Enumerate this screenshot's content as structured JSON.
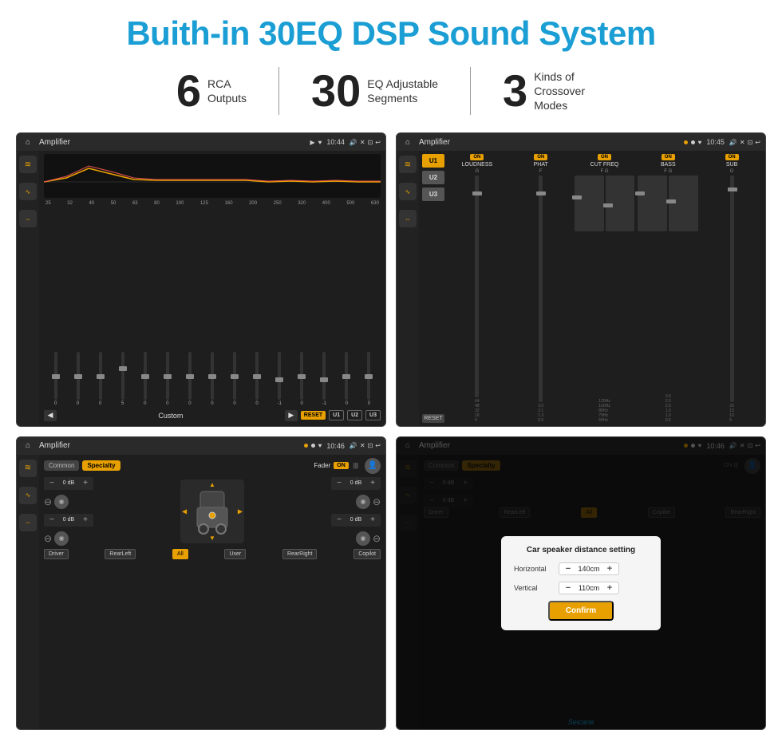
{
  "header": {
    "title": "Buith-in 30EQ DSP Sound System"
  },
  "stats": [
    {
      "number": "6",
      "label": "RCA\nOutputs"
    },
    {
      "number": "30",
      "label": "EQ Adjustable\nSegments"
    },
    {
      "number": "3",
      "label": "Kinds of\nCrossover Modes"
    }
  ],
  "screens": {
    "screen1": {
      "topbar": {
        "title": "Amplifier",
        "time": "10:44"
      },
      "eq_labels": [
        "25",
        "32",
        "40",
        "50",
        "63",
        "80",
        "100",
        "125",
        "160",
        "200",
        "250",
        "320",
        "400",
        "500",
        "630"
      ],
      "eq_values": [
        "0",
        "0",
        "0",
        "5",
        "0",
        "0",
        "0",
        "0",
        "0",
        "0",
        "-1",
        "0",
        "-1"
      ],
      "bottom": {
        "preset": "Custom",
        "reset": "RESET",
        "u1": "U1",
        "u2": "U2",
        "u3": "U3"
      }
    },
    "screen2": {
      "topbar": {
        "title": "Amplifier",
        "time": "10:45"
      },
      "channels": [
        {
          "on": true,
          "label": "LOUDNESS"
        },
        {
          "on": true,
          "label": "PHAT"
        },
        {
          "on": true,
          "label": "CUT FREQ"
        },
        {
          "on": true,
          "label": "BASS"
        },
        {
          "on": true,
          "label": "SUB"
        }
      ],
      "u_buttons": [
        "U1",
        "U2",
        "U3"
      ],
      "reset": "RESET"
    },
    "screen3": {
      "topbar": {
        "title": "Amplifier",
        "time": "10:46"
      },
      "tabs": [
        "Common",
        "Specialty"
      ],
      "fader_label": "Fader",
      "fader_on": "ON",
      "db_values": [
        "0 dB",
        "0 dB",
        "0 dB",
        "0 dB"
      ],
      "buttons": [
        "Driver",
        "RearLeft",
        "All",
        "User",
        "RearRight",
        "Copilot"
      ]
    },
    "screen4": {
      "topbar": {
        "title": "Amplifier",
        "time": "10:46"
      },
      "tabs": [
        "Common",
        "Specialty"
      ],
      "dialog": {
        "title": "Car speaker distance setting",
        "horizontal_label": "Horizontal",
        "horizontal_value": "140cm",
        "vertical_label": "Vertical",
        "vertical_value": "110cm",
        "confirm_label": "Confirm"
      },
      "buttons": [
        "Driver",
        "RearLeft",
        "Copilot",
        "RearRight"
      ],
      "db_values": [
        "0 dB",
        "0 dB"
      ]
    }
  },
  "watermark": "Seicane"
}
